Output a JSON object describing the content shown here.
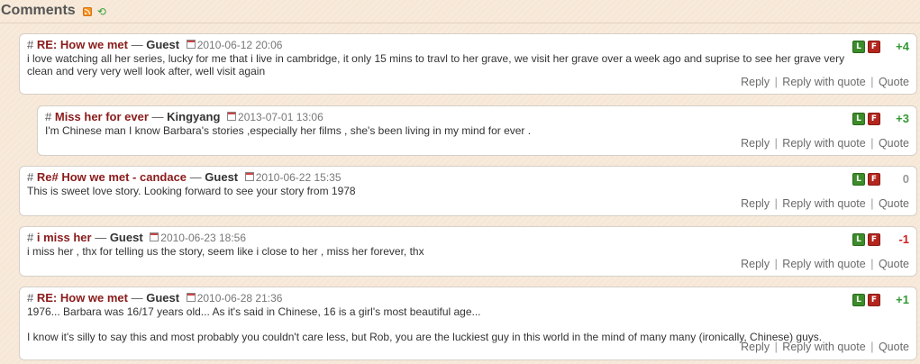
{
  "header": {
    "title": "Comments",
    "rss_icon": "rss-icon",
    "refresh_icon": "refresh-icon"
  },
  "actions": {
    "reply": "Reply",
    "reply_quote": "Reply with quote",
    "quote": "Quote",
    "sep": "|"
  },
  "colors": {
    "positive": "#339933",
    "negative": "#cc2222",
    "neutral": "#999999",
    "subject": "#8a1b1b"
  },
  "comments": [
    {
      "hash": "#",
      "subject": "RE: How we met",
      "dash": "—",
      "author": "Guest",
      "date": "2010-06-12 20:06",
      "body1": "i love watching all her series, lucky for me that i live in cambridge, it only 15 mins to travl to her grave, we visit her grave over a week ago and suprise to see her grave very",
      "body2": "clean and very very well look after, well visit again",
      "score": "+4"
    },
    {
      "hash": "#",
      "subject": "Miss her for ever",
      "dash": "—",
      "author": "Kingyang",
      "date": "2013-07-01 13:06",
      "body1": "I'm Chinese man I know Barbara's stories ,especially her films , she's been living in my mind for ever .",
      "score": "+3"
    },
    {
      "hash": "#",
      "subject": "Re# How we met - candace",
      "dash": "—",
      "author": "Guest",
      "date": "2010-06-22 15:35",
      "body1": "This is sweet love story. Looking forward to see your story from 1978",
      "score": "0"
    },
    {
      "hash": "#",
      "subject": "i miss her",
      "dash": "—",
      "author": "Guest",
      "date": "2010-06-23 18:56",
      "body1": "i miss her , thx for telling us the story, seem like i close to her , miss her forever, thx",
      "score": "-1"
    },
    {
      "hash": "#",
      "subject": "RE: How we met",
      "dash": "—",
      "author": "Guest",
      "date": "2010-06-28 21:36",
      "body1": "1976... Barbara was 16/17 years old... As it's said in Chinese, 16 is a girl's most beautiful age...",
      "body2": "I know it's silly to say this and most probably you couldn't care less, but Rob, you are the luckiest guy in this world in the mind of many many (ironically, Chinese) guys.",
      "score": "+1"
    }
  ]
}
